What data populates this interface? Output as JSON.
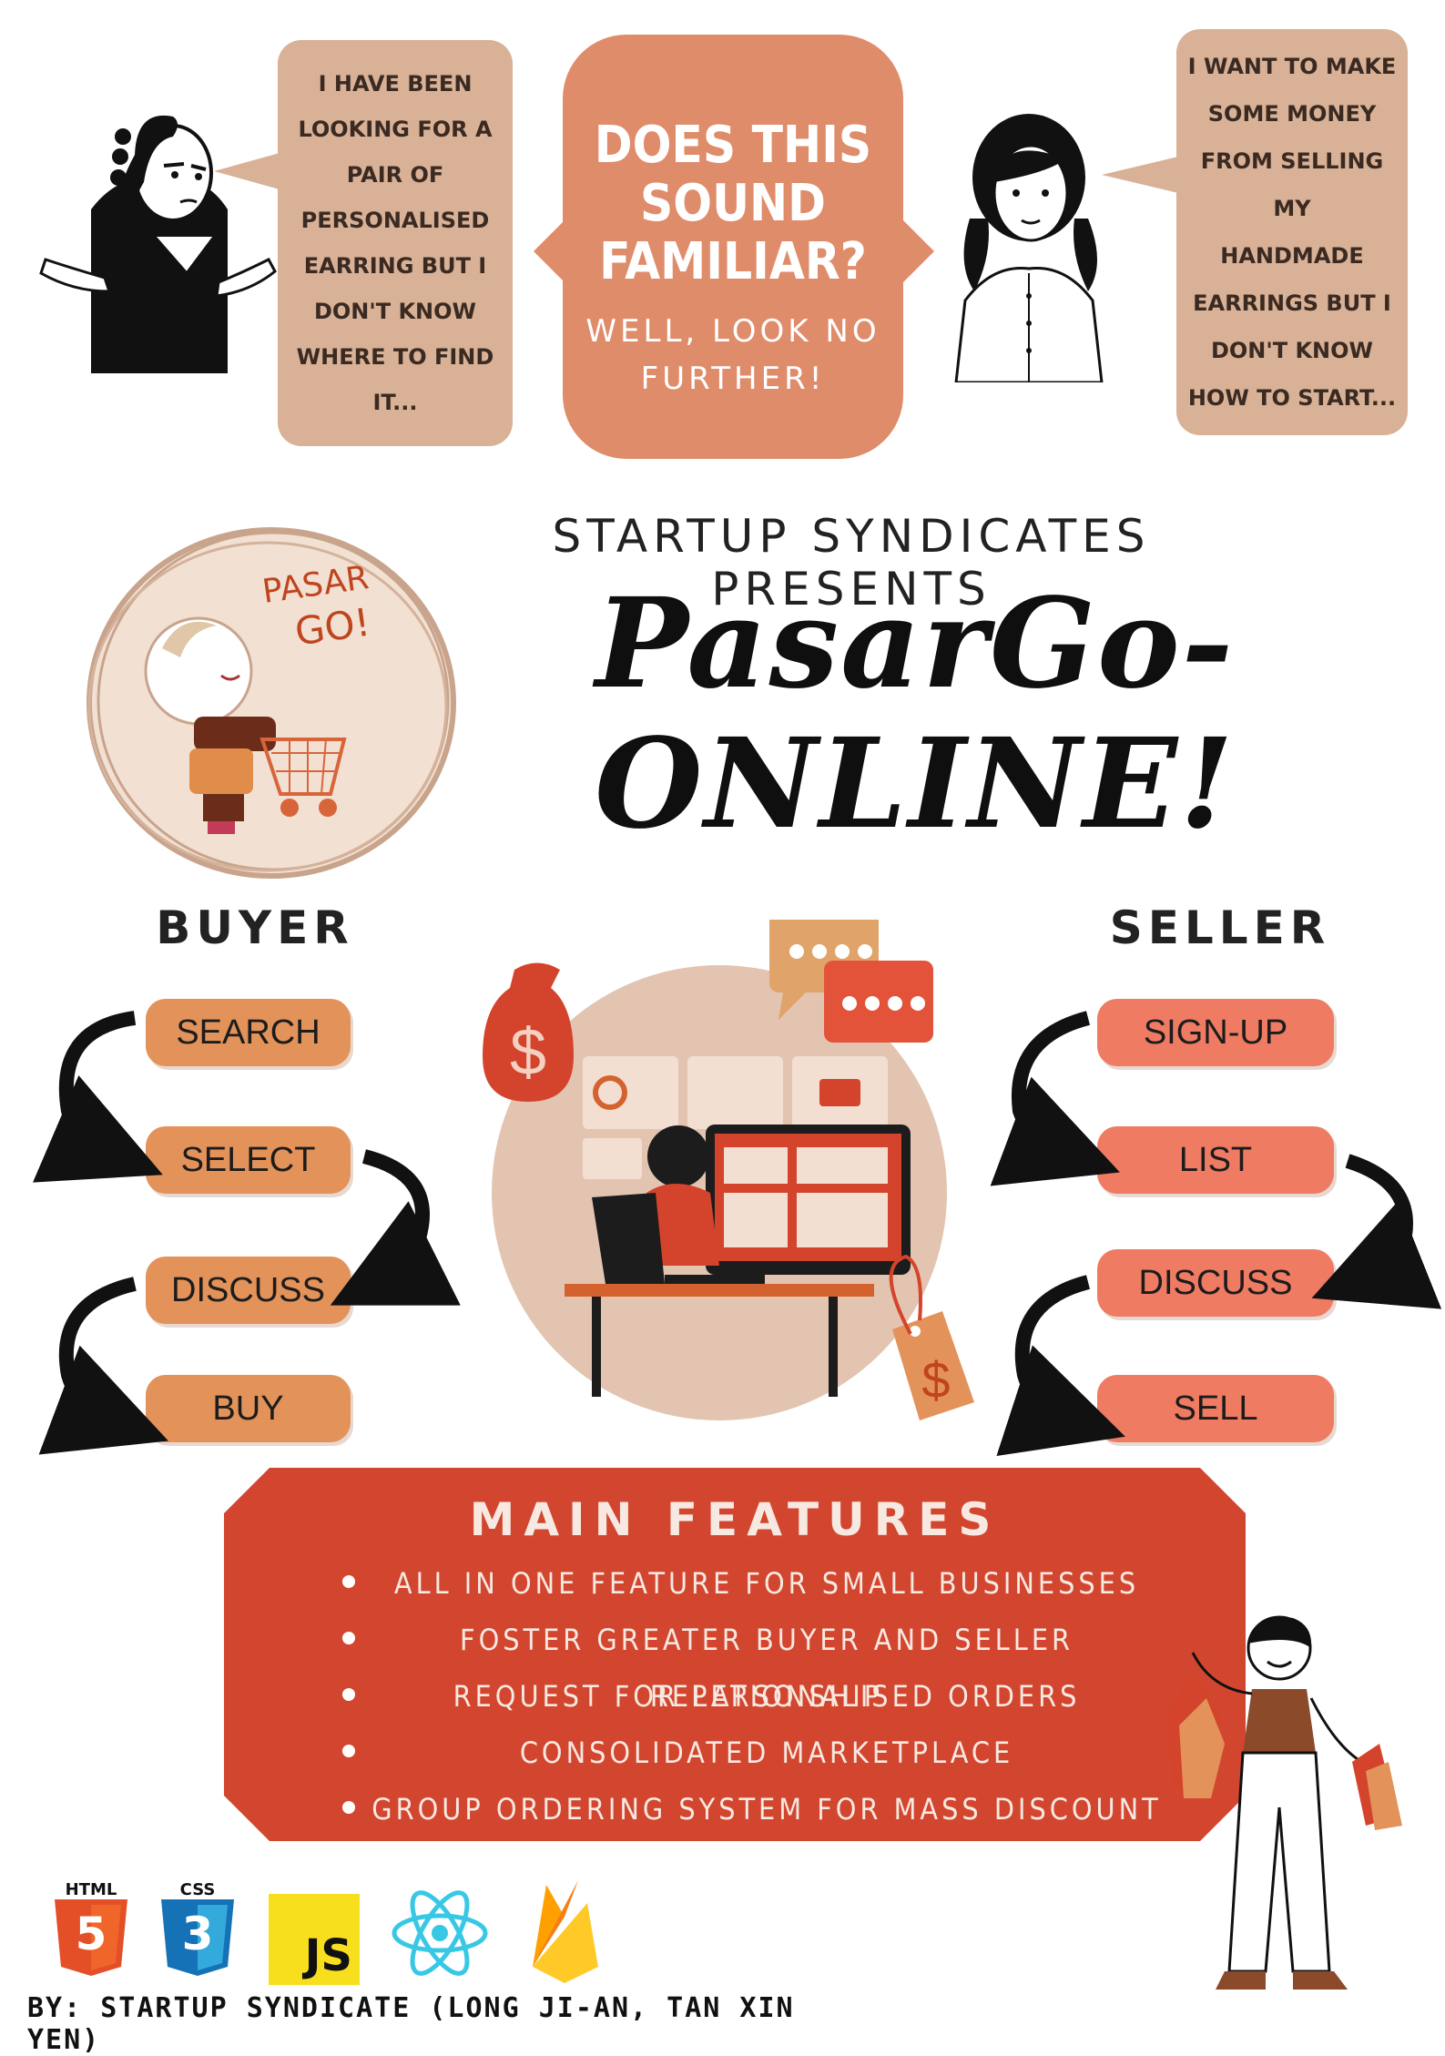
{
  "top": {
    "buyer_quote": "I have been\nlooking for a\npair of\npersonalised\nearring but I\ndon't know\nwhere to find\nit...",
    "center_heading": "DOES THIS SOUND FAMILIAR?",
    "center_sub": "WELL, LOOK NO FURTHER!",
    "seller_quote": "I want to make\nsome money\nfrom selling my\nhandmade\nearrings but I\ndon't know\nhow to start..."
  },
  "title": {
    "presenter": "STARTUP SYNDICATES PRESENTS",
    "logo_text_line1": "PASAR",
    "logo_text_line2": "GO!",
    "line1": "PasarGo-",
    "line2": "ONLINE!"
  },
  "flows": {
    "buyer": {
      "heading": "BUYER",
      "steps": [
        "SEARCH",
        "SELECT",
        "DISCUSS",
        "BUY"
      ]
    },
    "seller": {
      "heading": "SELLER",
      "steps": [
        "SIGN-UP",
        "LIST",
        "DISCUSS",
        "SELL"
      ]
    }
  },
  "features": {
    "heading": "MAIN FEATURES",
    "items": [
      "ALL IN ONE FEATURE FOR SMALL BUSINESSES",
      "FOSTER GREATER BUYER AND SELLER RELATIONSHIP",
      "REQUEST FOR PERSONALISED ORDERS",
      "CONSOLIDATED MARKETPLACE",
      "GROUP ORDERING SYSTEM FOR MASS DISCOUNT"
    ]
  },
  "tech": {
    "html_label": "HTML",
    "html_glyph": "5",
    "css_label": "CSS",
    "css_glyph": "3",
    "js_label": "JS",
    "icons": [
      "html5-icon",
      "css3-icon",
      "javascript-icon",
      "react-icon",
      "firebase-icon"
    ]
  },
  "footer": {
    "credit": "BY: STARTUP SYNDICATE (LONG JI-AN, TAN XIN YEN)"
  },
  "colors": {
    "bubble": "#d8b196",
    "center_bubble": "#df8c6a",
    "buyer_pill": "#e39259",
    "seller_pill": "#ee7b62",
    "features_panel": "#d2462f"
  }
}
